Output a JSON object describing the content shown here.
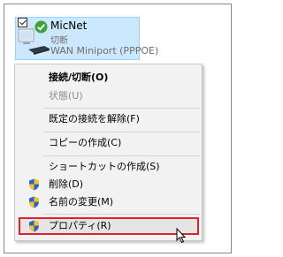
{
  "connection": {
    "name": "MicNet",
    "status": "切断",
    "device": "WAN Miniport (PPPOE)",
    "icons": [
      "checkbox-icon",
      "status-ok-icon",
      "network-computer-icon"
    ]
  },
  "context_menu": {
    "items": [
      {
        "label": "接続/切断(O)",
        "default": true
      },
      {
        "label": "状態(U)",
        "disabled": true
      },
      {
        "label": "既定の接続を解除(F)"
      },
      {
        "label": "コピーの作成(C)"
      },
      {
        "label": "ショートカットの作成(S)"
      },
      {
        "label": "削除(D)",
        "icon": "shield-icon"
      },
      {
        "label": "名前の変更(M)",
        "icon": "shield-icon"
      },
      {
        "label": "プロパティ(R)",
        "icon": "shield-icon",
        "hovered": true
      }
    ]
  },
  "colors": {
    "selection_background": "#cce8ff",
    "highlight_border": "#e0212b",
    "ok_badge": "#3aa33a",
    "shield_blue": "#2b62c8",
    "shield_yellow": "#f5c32c"
  }
}
